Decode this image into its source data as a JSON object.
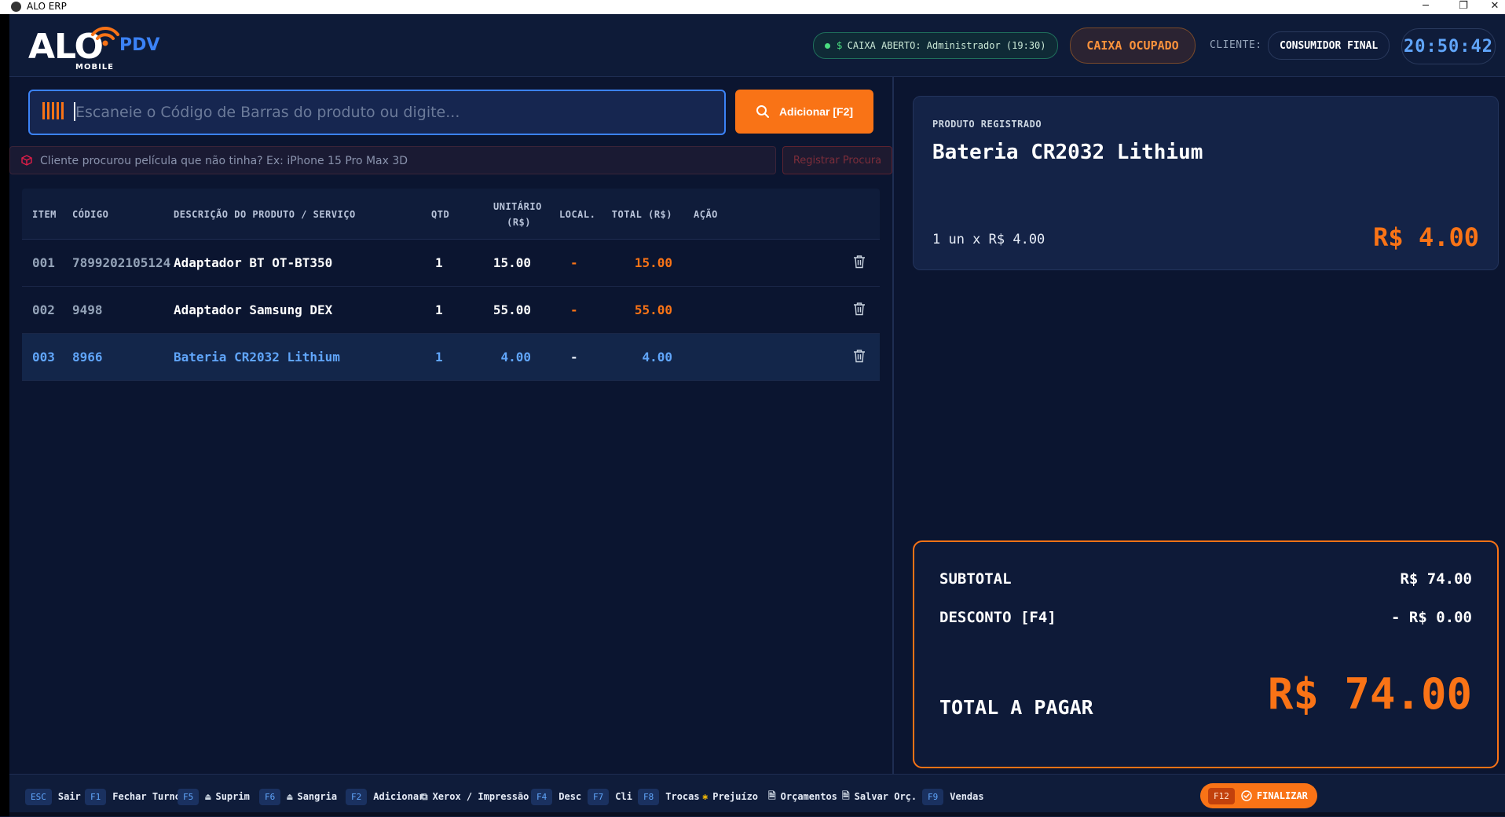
{
  "window": {
    "title": "ALO ERP"
  },
  "header": {
    "logo_text": "ALO",
    "logo_sub": "MOBILE",
    "module": "PDV",
    "caixa_status": "CAIXA ABERTO: Administrador (19:30)",
    "caixa_status_symbol": "$",
    "caixa_ocupado": "CAIXA OCUPADO",
    "cliente_label": "CLIENTE:",
    "cliente_value": "CONSUMIDOR FINAL",
    "clock": "20:50:42"
  },
  "search": {
    "placeholder": "Escaneie o Código de Barras do produto ou digite...",
    "add_button": "Adicionar [F2]"
  },
  "procura": {
    "placeholder": "Cliente procurou película que não tinha? Ex: iPhone 15 Pro Max 3D",
    "button": "Registrar Procura"
  },
  "table": {
    "headers": {
      "item": "ITEM",
      "codigo": "CÓDIGO",
      "descricao": "DESCRIÇÃO DO PRODUTO / SERVIÇO",
      "qtd": "QTD",
      "unitario_1": "UNITÁRIO",
      "unitario_2": "(R$)",
      "local": "LOCAL.",
      "total": "TOTAL (R$)",
      "acao": "AÇÃO"
    },
    "rows": [
      {
        "item": "001",
        "codigo": "7899202105124",
        "descricao": "Adaptador BT OT-BT350",
        "qtd": "1",
        "unitario": "15.00",
        "local": "-",
        "total": "15.00"
      },
      {
        "item": "002",
        "codigo": "9498",
        "descricao": "Adaptador Samsung DEX",
        "qtd": "1",
        "unitario": "55.00",
        "local": "-",
        "total": "55.00"
      },
      {
        "item": "003",
        "codigo": "8966",
        "descricao": "Bateria CR2032 Lithium",
        "qtd": "1",
        "unitario": "4.00",
        "local": "-",
        "total": "4.00"
      }
    ]
  },
  "produto": {
    "label": "PRODUTO REGISTRADO",
    "name": "Bateria CR2032 Lithium",
    "qty_line": "1 un x R$ 4.00",
    "price": "R$ 4.00"
  },
  "totais": {
    "subtotal_label": "SUBTOTAL",
    "subtotal_value": "R$ 74.00",
    "desconto_label": "DESCONTO [F4]",
    "desconto_value": "- R$ 0.00",
    "total_label": "TOTAL A PAGAR",
    "total_value": "R$ 74.00"
  },
  "shortcuts": [
    {
      "key": "ESC",
      "label": "Sair"
    },
    {
      "key": "F1",
      "label": "Fechar Turno"
    },
    {
      "key": "F5",
      "label": "Suprim"
    },
    {
      "key": "F6",
      "label": "Sangria"
    },
    {
      "key": "F2",
      "label": "Adicionar"
    },
    {
      "key": "",
      "label": "Xerox / Impressão"
    },
    {
      "key": "F4",
      "label": "Desc"
    },
    {
      "key": "F7",
      "label": "Cli"
    },
    {
      "key": "F8",
      "label": "Trocas"
    },
    {
      "key": "",
      "label": "Prejuízo"
    },
    {
      "key": "",
      "label": "Orçamentos"
    },
    {
      "key": "",
      "label": "Salvar Orç."
    },
    {
      "key": "F9",
      "label": "Vendas"
    },
    {
      "key": "F12",
      "label": "FINALIZAR"
    }
  ],
  "colors": {
    "accent": "#f97316",
    "primary": "#3b82f6",
    "success": "#4ade80",
    "background": "#0b1530"
  }
}
